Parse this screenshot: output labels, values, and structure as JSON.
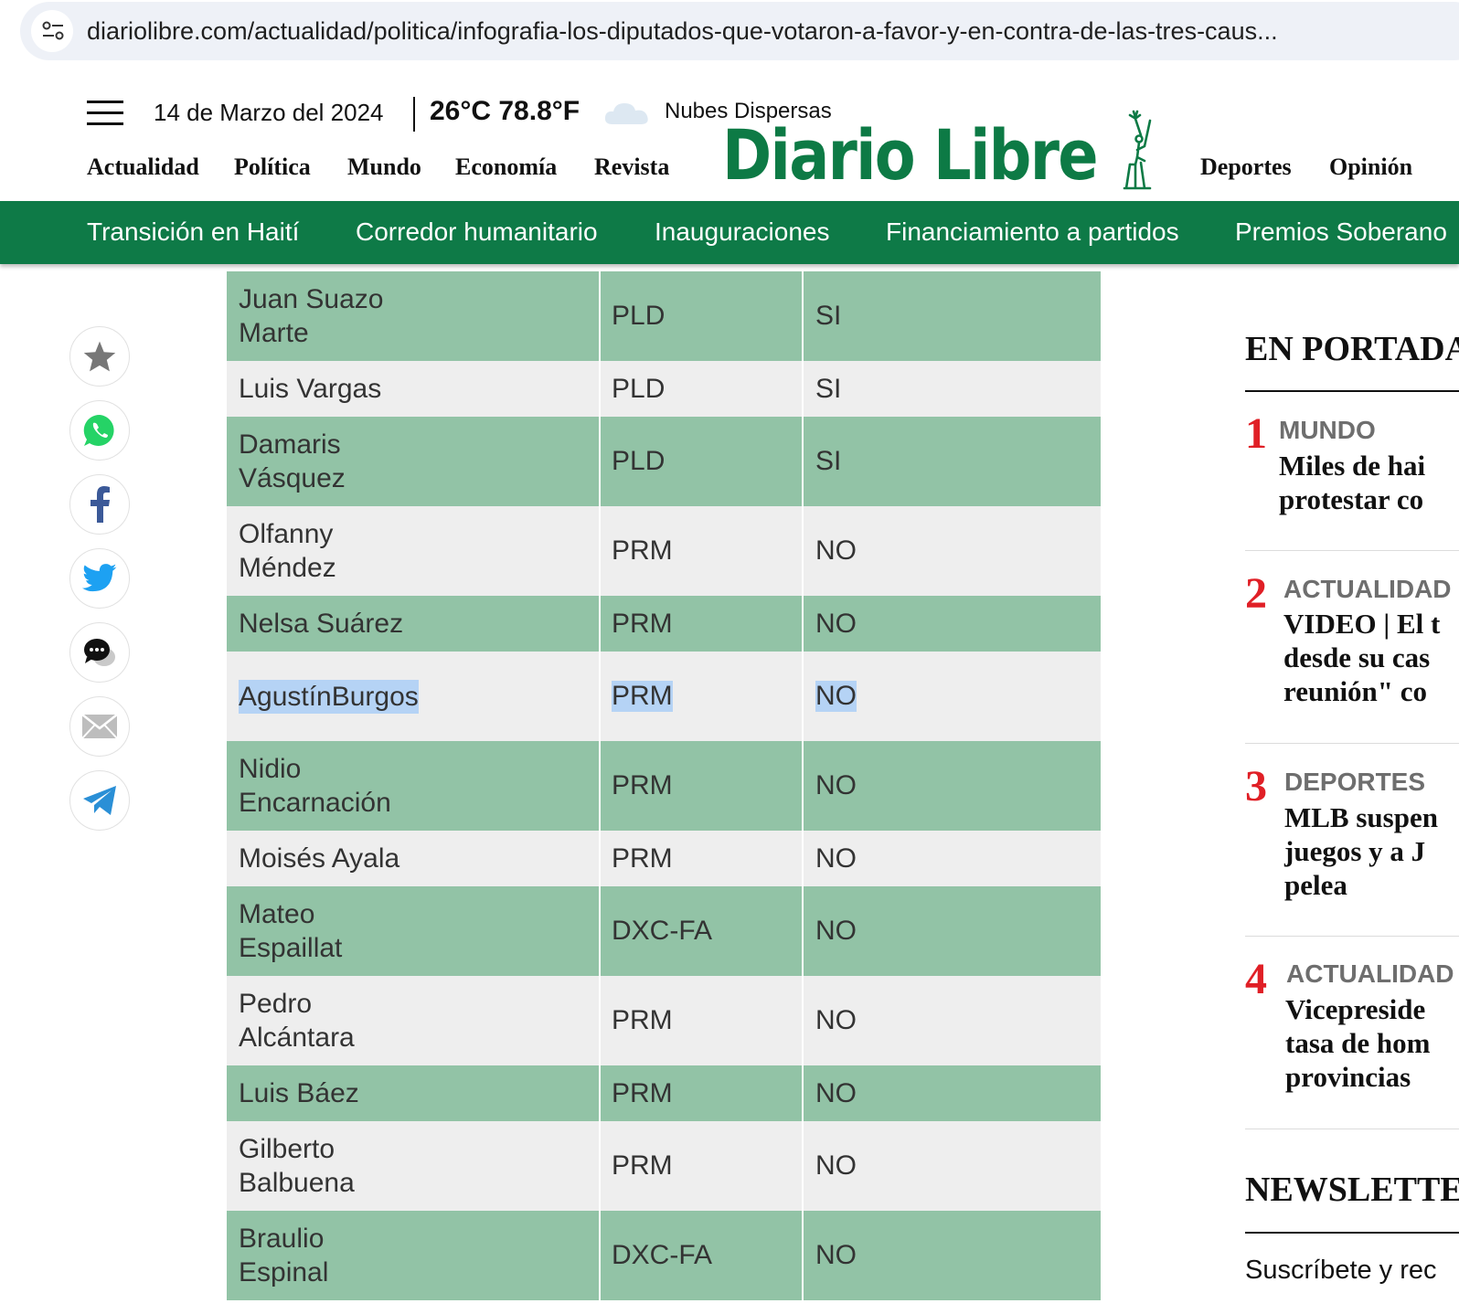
{
  "browser": {
    "url": "diariolibre.com/actualidad/politica/infografia-los-diputados-que-votaron-a-favor-y-en-contra-de-las-tres-caus..."
  },
  "header": {
    "date": "14 de Marzo del 2024",
    "temperature": "26°C 78.8°F",
    "weather": "Nubes Dispersas",
    "logo": "Diario Libre",
    "nav_left": [
      "Actualidad",
      "Política",
      "Mundo",
      "Economía",
      "Revista"
    ],
    "nav_right": [
      "Deportes",
      "Opinión"
    ]
  },
  "topics": [
    "Transición en Haití",
    "Corredor humanitario",
    "Inauguraciones",
    "Financiamiento a partidos",
    "Premios Soberano"
  ],
  "share_icons": [
    "star-icon",
    "whatsapp-icon",
    "facebook-icon",
    "twitter-icon",
    "comments-icon",
    "email-icon",
    "telegram-icon"
  ],
  "table": {
    "rows": [
      {
        "name": [
          "Juan Suazo",
          "Marte"
        ],
        "party": "PLD",
        "vote": "SI"
      },
      {
        "name": [
          "Luis Vargas"
        ],
        "party": "PLD",
        "vote": "SI"
      },
      {
        "name": [
          "Damaris",
          "Vásquez"
        ],
        "party": "PLD",
        "vote": "SI"
      },
      {
        "name": [
          "Olfanny",
          "Méndez"
        ],
        "party": "PRM",
        "vote": "NO"
      },
      {
        "name": [
          "Nelsa Suárez"
        ],
        "party": "PRM",
        "vote": "NO"
      },
      {
        "name": [
          "Agustín",
          "Burgos"
        ],
        "party": "PRM",
        "vote": "NO",
        "selected": true
      },
      {
        "name": [
          "Nidio",
          "Encarnación"
        ],
        "party": "PRM",
        "vote": "NO"
      },
      {
        "name": [
          "Moisés Ayala"
        ],
        "party": "PRM",
        "vote": "NO"
      },
      {
        "name": [
          "Mateo",
          "Espaillat"
        ],
        "party": "DXC-FA",
        "vote": "NO"
      },
      {
        "name": [
          "Pedro",
          "Alcántara"
        ],
        "party": "PRM",
        "vote": "NO"
      },
      {
        "name": [
          "Luis Báez"
        ],
        "party": "PRM",
        "vote": "NO"
      },
      {
        "name": [
          "Gilberto",
          "Balbuena"
        ],
        "party": "PRM",
        "vote": "NO"
      },
      {
        "name": [
          "Braulio",
          "Espinal"
        ],
        "party": "DXC-FA",
        "vote": "NO"
      }
    ]
  },
  "sidebar": {
    "title": "EN PORTADA",
    "items": [
      {
        "num": "1",
        "category": "MUNDO",
        "lines": [
          "Miles de hai",
          "protestar co"
        ]
      },
      {
        "num": "2",
        "category": "ACTUALIDAD",
        "lines": [
          "VIDEO | El t",
          "desde su cas",
          "reunión\" co"
        ]
      },
      {
        "num": "3",
        "category": "DEPORTES",
        "lines": [
          "MLB suspen",
          "juegos y a J",
          "pelea"
        ]
      },
      {
        "num": "4",
        "category": "ACTUALIDAD",
        "lines": [
          "Vicepreside",
          "tasa de hom",
          "provincias"
        ]
      }
    ],
    "newsletter_title": "NEWSLETTER",
    "newsletter_text": "Suscríbete y rec"
  },
  "colors": {
    "brand_green": "#0e7a47",
    "row_green": "#92c3a6",
    "row_gray": "#eeeeee",
    "number_red": "#e01f26",
    "selection": "#b5d3f5"
  }
}
